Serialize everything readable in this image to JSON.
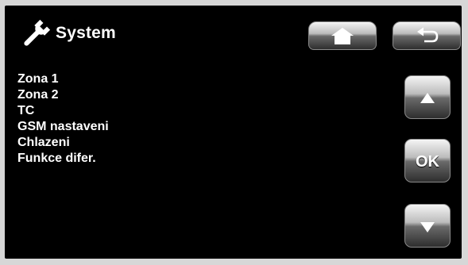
{
  "header": {
    "title": "System",
    "icon": "wrench-icon"
  },
  "nav": {
    "home_icon": "home-icon",
    "back_icon": "back-arrow-icon"
  },
  "menu": {
    "items": [
      {
        "label": "Zona 1"
      },
      {
        "label": "Zona 2"
      },
      {
        "label": "TC"
      },
      {
        "label": "GSM nastaveni"
      },
      {
        "label": "Chlazeni"
      },
      {
        "label": "Funkce difer."
      }
    ]
  },
  "controls": {
    "up_icon": "arrow-up-icon",
    "ok_label": "OK",
    "down_icon": "arrow-down-icon"
  },
  "colors": {
    "screen_background": "#000000",
    "text": "#ffffff",
    "bezel": "#d7d7d7"
  }
}
